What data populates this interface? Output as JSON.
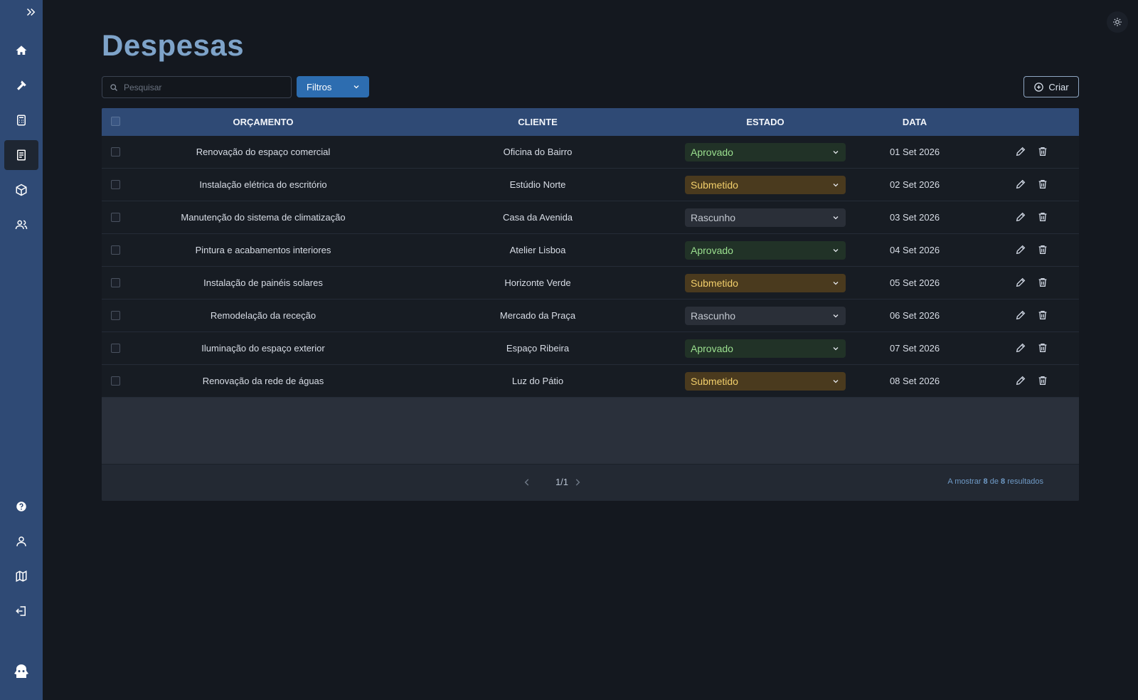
{
  "page": {
    "title": "Despesas"
  },
  "sidebar": {
    "top_items": [
      {
        "icon": "home-icon"
      },
      {
        "icon": "hammer-icon"
      },
      {
        "icon": "calculator-icon"
      },
      {
        "icon": "document-icon",
        "active": true
      },
      {
        "icon": "package-icon"
      },
      {
        "icon": "users-icon"
      }
    ],
    "bottom_items": [
      {
        "icon": "help-icon"
      },
      {
        "icon": "user-icon"
      },
      {
        "icon": "map-icon"
      },
      {
        "icon": "logout-icon"
      },
      {
        "icon": "logo-icon"
      }
    ]
  },
  "toolbar": {
    "search_placeholder": "Pesquisar",
    "filters_label": "Filtros",
    "create_label": "Criar"
  },
  "table": {
    "columns": [
      "ORÇAMENTO",
      "CLIENTE",
      "ESTADO",
      "DATA"
    ],
    "rows": [
      {
        "orcamento": "Renovação do espaço comercial",
        "cliente": "Oficina do Bairro",
        "estado": "Aprovado",
        "data": "01 Set 2026"
      },
      {
        "orcamento": "Instalação elétrica do escritório",
        "cliente": "Estúdio Norte",
        "estado": "Submetido",
        "data": "02 Set 2026"
      },
      {
        "orcamento": "Manutenção do sistema de climatização",
        "cliente": "Casa da Avenida",
        "estado": "Rascunho",
        "data": "03 Set 2026"
      },
      {
        "orcamento": "Pintura e acabamentos interiores",
        "cliente": "Atelier Lisboa",
        "estado": "Aprovado",
        "data": "04 Set 2026"
      },
      {
        "orcamento": "Instalação de painéis solares",
        "cliente": "Horizonte Verde",
        "estado": "Submetido",
        "data": "05 Set 2026"
      },
      {
        "orcamento": "Remodelação da receção",
        "cliente": "Mercado da Praça",
        "estado": "Rascunho",
        "data": "06 Set 2026"
      },
      {
        "orcamento": "Iluminação do espaço exterior",
        "cliente": "Espaço Ribeira",
        "estado": "Aprovado",
        "data": "07 Set 2026"
      },
      {
        "orcamento": "Renovação da rede de águas",
        "cliente": "Luz do Pátio",
        "estado": "Submetido",
        "data": "08 Set 2026"
      }
    ]
  },
  "pagination": {
    "label": "1/1",
    "results_prefix": "A mostrar",
    "shown": "8",
    "results_mid": "de",
    "total": "8",
    "results_suffix": "resultados"
  },
  "colors": {
    "sidebar": "#2f4a75",
    "background": "#14181f",
    "aprovado": "#9be08f",
    "submetido": "#f2cf6b",
    "rascunho": "#c3c8d0"
  }
}
